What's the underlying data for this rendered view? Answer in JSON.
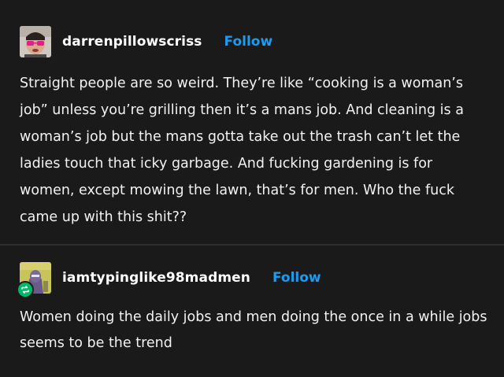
{
  "posts": [
    {
      "username": "darrenpillowscriss",
      "follow_label": "Follow",
      "avatar_icon": "user-avatar-red-glasses",
      "text": "Straight people are so weird. They’re like “cooking is a woman’s job” unless you’re grilling then it’s a mans job. And cleaning is a woman’s job but the mans gotta take out the trash can’t let the ladies touch that icky garbage. And fucking gardening is for women, except mowing the lawn, that’s for men. Who the fuck came up with this shit??"
    },
    {
      "username": "iamtypinglike98madmen",
      "follow_label": "Follow",
      "avatar_icon": "user-avatar-purple-figure",
      "reblog_icon": "reblog-icon",
      "text": "Women doing the daily jobs and men doing the once in a while jobs seems to be the trend"
    }
  ],
  "colors": {
    "background": "#1a1a1a",
    "accent": "#1d9bf0",
    "reblog": "#00b86b"
  }
}
